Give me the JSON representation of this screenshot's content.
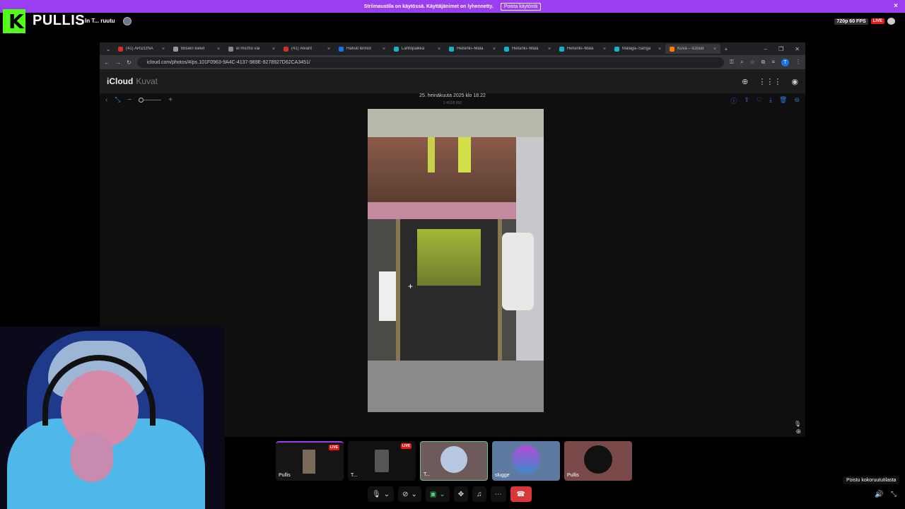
{
  "banner": {
    "message": "Striimaustila on käytössä. Käyttäjänimet on lyhennetty.",
    "disable_label": "Poista käytöstä",
    "close_icon": "×"
  },
  "overlay": {
    "logo_letter": "K",
    "streamer_name": "PULLIS",
    "status_text": "In T... ruutu",
    "quality_badge": "720p 60 FPS",
    "live_badge": "LIVE"
  },
  "browser": {
    "tabs": [
      {
        "label": "(41) ARIZONA",
        "color": "#d32f2f"
      },
      {
        "label": "Biisien kielet",
        "color": "#999999"
      },
      {
        "label": "el micmo vai",
        "color": "#888888"
      },
      {
        "label": "(41) Älvarit",
        "color": "#d32f2f"
      },
      {
        "label": "Halvat lennot",
        "color": "#1a73e8"
      },
      {
        "label": "Lähtöpaikka",
        "color": "#1ab0c8"
      },
      {
        "label": "Helsinki–Mála",
        "color": "#1ab0c8"
      },
      {
        "label": "Helsinki–Mála",
        "color": "#1ab0c8"
      },
      {
        "label": "Helsinki–Mála",
        "color": "#1ab0c8"
      },
      {
        "label": "Málaga–Sanga",
        "color": "#1ab0c8"
      },
      {
        "label": "Kuva – iCloud",
        "color": "#ff7a00"
      }
    ],
    "new_tab": "+",
    "url": "icloud.com/photos/#/ps.101F0963-9A4C-4137-989E-9278927D62CA3451/",
    "profile_letter": "T"
  },
  "icloud": {
    "brand": "iCloud",
    "section": "Kuvat",
    "photo_date": "25. heinäkuuta 2025 klo 18.22",
    "photo_meta": "3 452/8 830"
  },
  "call": {
    "participants": [
      {
        "name": "Pullis",
        "live": "LIVE"
      },
      {
        "name": "T...",
        "live": "LIVE"
      },
      {
        "name": "T..."
      },
      {
        "name": "slugge"
      },
      {
        "name": "Pullis"
      }
    ],
    "tooltip": "Poistu kokoruututilasta"
  }
}
